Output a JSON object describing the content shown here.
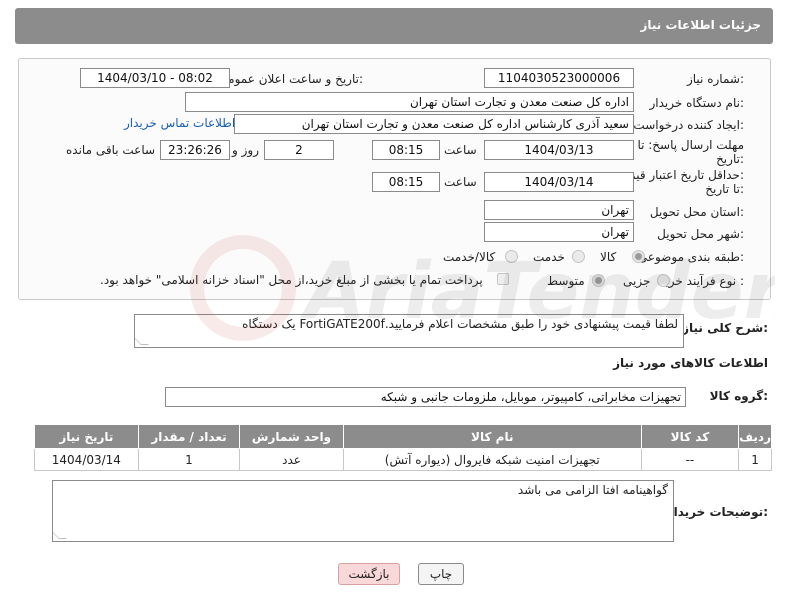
{
  "header": {
    "title": "جزئیات اطلاعات نیاز"
  },
  "form": {
    "need_number_label": "شماره نیاز:",
    "need_number": "1104030523000006",
    "announce_label": "تاریخ و ساعت اعلان عمومی:",
    "announce_value": "1404/03/10 - 08:02",
    "buyer_org_label": "نام دستگاه خریدار:",
    "buyer_org": "اداره کل صنعت  معدن و تجارت استان تهران",
    "requester_label": "ایجاد کننده درخواست:",
    "requester": "سعید آذری کارشناس اداره کل صنعت  معدن و تجارت استان تهران",
    "contact_link": "اطلاعات تماس خریدار",
    "deadline_label_1": "مهلت ارسال پاسخ: تا",
    "deadline_label_2": "تاریخ:",
    "deadline_date": "1404/03/13",
    "time_label": "ساعت",
    "deadline_time": "08:15",
    "days_value": "2",
    "days_label": "روز و",
    "remaining_time": "23:26:26",
    "remaining_label": "ساعت باقی مانده",
    "min_validity_label_1": "حداقل تاریخ اعتبار قیمت:",
    "min_validity_label_2": "تا تاریخ:",
    "validity_date": "1404/03/14",
    "validity_time": "08:15",
    "province_label": "استان محل تحویل:",
    "province": "تهران",
    "city_label": "شهر محل تحویل:",
    "city": "تهران",
    "category_label": "طبقه بندی موضوعی:",
    "category_options": [
      "کالا",
      "خدمت",
      "کالا/خدمت"
    ],
    "process_label": "نوع فرآیند خرید :",
    "process_options": [
      "جزیی",
      "متوسط"
    ],
    "payment_note": "پرداخت تمام یا بخشی از مبلغ خرید،از محل \"اسناد خزانه اسلامی\" خواهد بود."
  },
  "description": {
    "label": "شرح کلی نیاز:",
    "text": "لطفا قیمت پیشنهادی خود را طبق مشخصات  اعلام فرمایید.FortiGATE200f یک دستگاه"
  },
  "goods_section": {
    "title": "اطلاعات کالاهای مورد نیاز",
    "group_label": "گروه کالا:",
    "group_value": "تجهیزات مخابراتی، کامپیوتر، موبایل، ملزومات جانبی و شبکه"
  },
  "table": {
    "headers": [
      "ردیف",
      "کد کالا",
      "نام کالا",
      "واحد شمارش",
      "تعداد / مقدار",
      "تاریخ نیاز"
    ],
    "rows": [
      [
        "1",
        "--",
        "تجهیزات امنیت شبکه فایروال (دیواره آتش)",
        "عدد",
        "1",
        "1404/03/14"
      ]
    ]
  },
  "buyer_notes": {
    "label": "توضیحات خریدار:",
    "text": "گواهینامه افتا الزامی می باشد"
  },
  "buttons": {
    "print": "چاپ",
    "back": "بازگشت"
  },
  "watermark": {
    "text": "AriaTender.net"
  }
}
